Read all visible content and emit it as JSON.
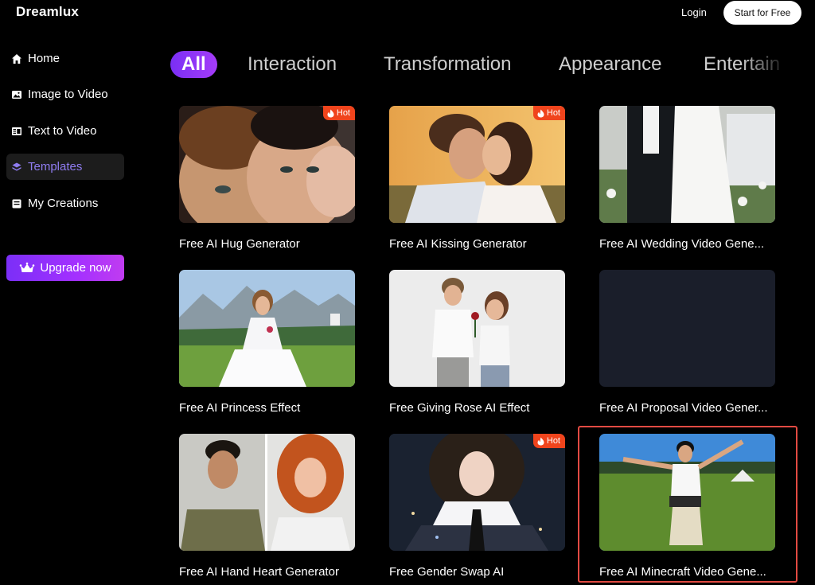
{
  "header": {
    "brand": "Dreamlux",
    "login_label": "Login",
    "start_label": "Start for Free"
  },
  "sidebar": {
    "items": [
      {
        "label": "Home",
        "icon": "home-icon"
      },
      {
        "label": "Image to Video",
        "icon": "image-icon"
      },
      {
        "label": "Text to Video",
        "icon": "text-doc-icon"
      },
      {
        "label": "Templates",
        "icon": "layers-icon",
        "active": true
      },
      {
        "label": "My Creations",
        "icon": "folder-icon"
      }
    ],
    "upgrade_label": "Upgrade now"
  },
  "tabs": [
    "All",
    "Interaction",
    "Transformation",
    "Appearance",
    "Entertain"
  ],
  "hot_label": "Hot",
  "cards": [
    {
      "title": "Free AI Hug Generator",
      "hot": true
    },
    {
      "title": "Free AI Kissing Generator",
      "hot": true
    },
    {
      "title": "Free AI Wedding Video Gene...",
      "hot": false
    },
    {
      "title": "Free AI Princess Effect",
      "hot": false
    },
    {
      "title": "Free Giving Rose AI Effect",
      "hot": false
    },
    {
      "title": "Free AI Proposal Video Gener...",
      "hot": false
    },
    {
      "title": "Free AI Hand Heart Generator",
      "hot": false
    },
    {
      "title": "Free Gender Swap AI",
      "hot": true
    },
    {
      "title": "Free AI Minecraft Video Gene...",
      "hot": false,
      "highlighted": true
    }
  ],
  "colors": {
    "accent": "#8f7cf0",
    "hot": "#f0441c",
    "highlight_border": "#e24a42"
  }
}
